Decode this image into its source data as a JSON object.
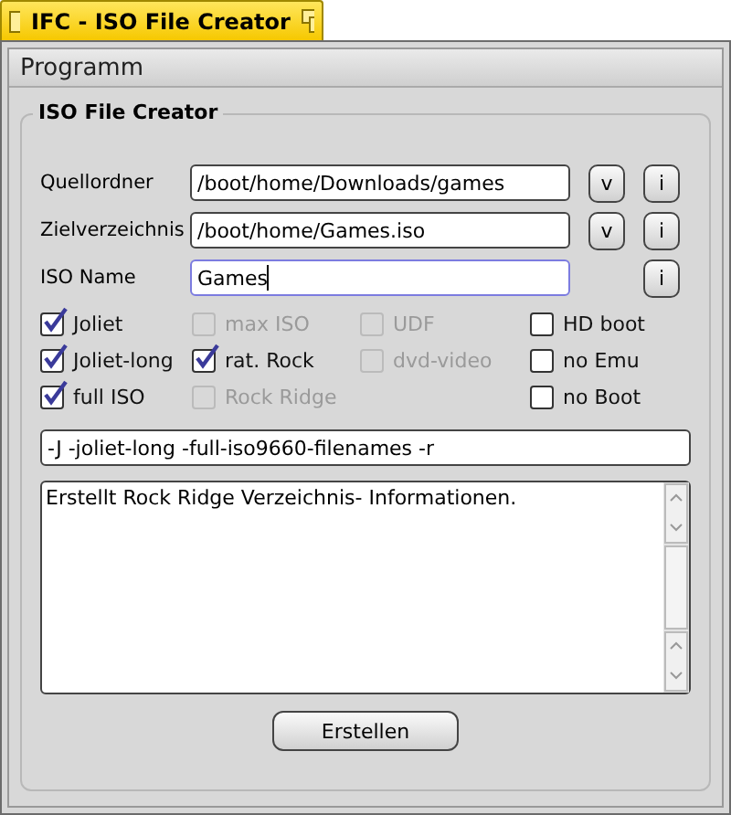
{
  "window": {
    "title": "IFC - ISO File Creator"
  },
  "menu": [
    "Programm"
  ],
  "group": {
    "title": "ISO File Creator"
  },
  "fields": [
    {
      "label": "Quellordner",
      "value": "/boot/home/Downloads/games",
      "focused": false,
      "buttons": [
        "v",
        "i"
      ]
    },
    {
      "label": "Zielverzeichnis",
      "value": "/boot/home/Games.iso",
      "focused": false,
      "buttons": [
        "v",
        "i"
      ]
    },
    {
      "label": "ISO Name",
      "value": "Games",
      "focused": true,
      "buttons": [
        "i"
      ]
    }
  ],
  "option_columns": [
    [
      {
        "label": "Joliet",
        "checked": true,
        "disabled": false
      },
      {
        "label": "Joliet-long",
        "checked": true,
        "disabled": false
      },
      {
        "label": "full ISO",
        "checked": true,
        "disabled": false
      }
    ],
    [
      {
        "label": "max ISO",
        "checked": false,
        "disabled": true
      },
      {
        "label": "rat. Rock",
        "checked": true,
        "disabled": false
      },
      {
        "label": "Rock Ridge",
        "checked": false,
        "disabled": true
      }
    ],
    [
      {
        "label": "UDF",
        "checked": false,
        "disabled": true
      },
      {
        "label": "dvd-video",
        "checked": false,
        "disabled": true
      }
    ],
    [
      {
        "label": "HD boot",
        "checked": false,
        "disabled": false
      },
      {
        "label": "no Emu",
        "checked": false,
        "disabled": false
      },
      {
        "label": "no Boot",
        "checked": false,
        "disabled": false
      }
    ]
  ],
  "command": "-J -joliet-long -full-iso9660-filenames -r",
  "description": "Erstellt Rock Ridge Verzeichnis- Informationen.",
  "buttons": [
    "Erstellen"
  ]
}
